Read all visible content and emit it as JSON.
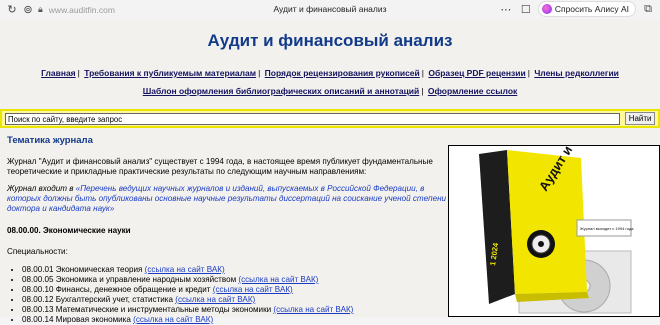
{
  "browser": {
    "url": "www.auditfin.com",
    "page_title": "Аудит и финансовый анализ",
    "alice_label": "Спросить Алису AI"
  },
  "site": {
    "heading": "Аудит и финансовый анализ",
    "nav_row1": [
      "Главная",
      "Требования к публикуемым материалам",
      "Порядок рецензирования рукописей",
      "Образец PDF рецензии",
      "Члены редколлегии"
    ],
    "nav_row2": [
      "Шаблон оформления библиографических описаний и аннотаций",
      "Оформление ссылок"
    ]
  },
  "search": {
    "value": "Поиск по сайту, введите запрос",
    "button_label": "Найти"
  },
  "content": {
    "section_title": "Тематика журнала",
    "intro": "Журнал \"Аудит и финансовый анализ\" существует с 1994 года, в настоящее время публикует фундаментальные теоретические и прикладные практические результаты по следующим научным направлениям:",
    "vak_prefix": "Журнал входит в ",
    "vak_link": "«Перечень ведущих научных журналов и изданий, выпускаемых в Российской Федерации, в которых должны быть опубликованы основные научные результаты диссертаций на соискание ученой степени доктора и кандидата наук»",
    "field": "08.00.00. Экономические науки",
    "specialties_label": "Специальности:",
    "specialties": [
      {
        "name": "08.00.01 Экономическая теория",
        "link": "(ссылка на сайт ВАК)"
      },
      {
        "name": "08.00.05 Экономика и управление народным хозяйством",
        "link": "(ссылка на сайт ВАК)"
      },
      {
        "name": "08.00.10 Финансы, денежное обращение и кредит",
        "link": "(ссылка на сайт ВАК)"
      },
      {
        "name": "08.00.12 Бухгалтерский учет, статистика",
        "link": "(ссылка на сайт ВАК)"
      },
      {
        "name": "08.00.13 Математические и инструментальные методы экономики",
        "link": "(ссылка на сайт ВАК)"
      },
      {
        "name": "08.00.14 Мировая экономика",
        "link": "(ссылка на сайт ВАК)"
      }
    ]
  },
  "book": {
    "title_image_text": "Аудит и финансовый анализ",
    "year_text": "1 2024",
    "sticker_text": "Журнал выходит с 1994 года"
  },
  "colors": {
    "heading": "#123a8a",
    "link": "#1a3cc4",
    "search_border": "#e8e600",
    "search_bg": "#fff79a",
    "book_yellow": "#f2e600"
  }
}
